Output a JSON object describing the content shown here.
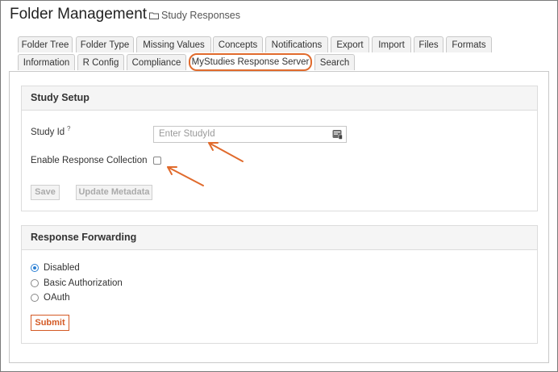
{
  "header": {
    "title": "Folder Management",
    "breadcrumb": "Study Responses"
  },
  "tabs_row1": [
    "Folder Tree",
    "Folder Type",
    "Missing Values",
    "Concepts",
    "Notifications",
    "Export",
    "Import",
    "Files",
    "Formats"
  ],
  "tabs_row2": [
    "Information",
    "R Config",
    "Compliance",
    "MyStudies Response Server",
    "Search"
  ],
  "active_tab": "MyStudies Response Server",
  "study_setup": {
    "heading": "Study Setup",
    "study_id_label": "Study Id",
    "help_mark": "?",
    "study_id_placeholder": "Enter StudyId",
    "study_id_value": "",
    "enable_label": "Enable Response Collection",
    "enable_checked": false,
    "save_label": "Save",
    "update_label": "Update Metadata"
  },
  "response_forwarding": {
    "heading": "Response Forwarding",
    "options": [
      "Disabled",
      "Basic Authorization",
      "OAuth"
    ],
    "selected": "Disabled",
    "submit_label": "Submit"
  },
  "colors": {
    "accent": "#e06a2c",
    "radio_selected": "#2a7fd4"
  },
  "icons": [
    "folder-icon",
    "input-clipboard-icon",
    "annotation-arrow"
  ]
}
